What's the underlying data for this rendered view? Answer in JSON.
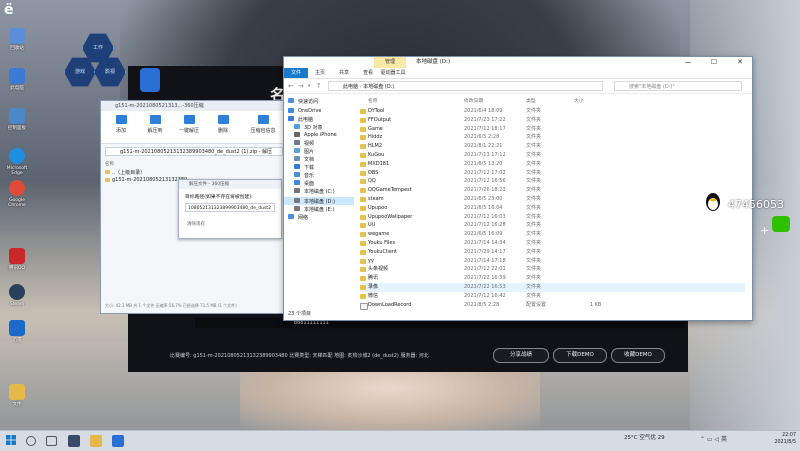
{
  "desktop": {
    "logo_text": "ë",
    "icons": [
      {
        "label": "回收站",
        "color": "#5a8fd8"
      },
      {
        "label": "此电脑",
        "color": "#3b7bd6"
      },
      {
        "label": "控制面板",
        "color": "#4a88c9"
      },
      {
        "label": "Microsoft Edge",
        "color": "#1f8fe0"
      },
      {
        "label": "Google Chrome",
        "color": "#e04a3a"
      },
      {
        "label": "腾讯QQ",
        "color": "#c8282a"
      },
      {
        "label": "Steam",
        "color": "#2a3f5a"
      },
      {
        "label": "迅雷",
        "color": "#1b69c9"
      },
      {
        "label": "文件",
        "color": "#e4b84a"
      }
    ],
    "launcher": [
      "工作",
      "游戏",
      "影视"
    ]
  },
  "stream_overlay": {
    "title": "名 热 沙 坝",
    "user": "bo811111111",
    "info": "比赛编号: g151-m-20210805213132389903480 比赛类型: 天梯匹配 地图: 炙热沙城2 (de_dust2) 服务器: 河北",
    "buttons": [
      "分享战绩",
      "下载DEMO",
      "收藏DEMO"
    ]
  },
  "zip_window": {
    "title": "g151-m-2021080521313...-360压缩",
    "tools": [
      "添加",
      "解压到",
      "一键解压",
      "删除",
      "压缩包信息"
    ],
    "path": "g151-m-20210805213132389903480_de_dust2 (1).zip - 解压",
    "header": "名称",
    "rows": [
      "..（上级目录）",
      "g151-m-20210805213132389..."
    ],
    "status": "大小: 42.1 MB 共 1 个文件 压缩率 56.7% 已经选择 71.5 MB (1 个文件)"
  },
  "extract_dialog": {
    "title": "解压文件 - 360压缩",
    "message": "目标路径(如果不存在将被创建):",
    "target": "108052131323899903480_de_dust2",
    "option": "清除现有"
  },
  "explorer": {
    "context_tab": "管理",
    "window_title": "本地磁盘 (D:)",
    "controls": [
      "—",
      "☐",
      "✕"
    ],
    "ribbon_tabs": [
      "文件",
      "主页",
      "共享",
      "查看",
      "驱动器工具"
    ],
    "address": [
      "此电脑",
      "本地磁盘 (D:)"
    ],
    "search_placeholder": "搜索\"本地磁盘 (D:)\"",
    "nav": [
      {
        "label": "快速访问",
        "color": "#4a8fe0"
      },
      {
        "label": "OneDrive",
        "color": "#3c8be0"
      },
      {
        "label": "此电脑",
        "color": "#3b7bd6"
      },
      {
        "label": "3D 对象",
        "color": "#4fa1d9"
      },
      {
        "label": "Apple iPhone",
        "color": "#666666"
      },
      {
        "label": "视频",
        "color": "#6b7b8c"
      },
      {
        "label": "图片",
        "color": "#5aa6d6"
      },
      {
        "label": "文档",
        "color": "#6b8fb8"
      },
      {
        "label": "下载",
        "color": "#2f7ed8"
      },
      {
        "label": "音乐",
        "color": "#4a8fe0"
      },
      {
        "label": "桌面",
        "color": "#3c8be0"
      },
      {
        "label": "本地磁盘 (C:)",
        "color": "#777777"
      },
      {
        "label": "本地磁盘 (D:)",
        "color": "#777777"
      },
      {
        "label": "本地磁盘 (E:)",
        "color": "#777777"
      },
      {
        "label": "网络",
        "color": "#4a8fe0"
      }
    ],
    "columns": [
      "名称",
      "修改日期",
      "类型",
      "大小"
    ],
    "files": [
      {
        "name": "DYTool",
        "date": "2021/6/4 18:09",
        "type": "文件夹",
        "size": ""
      },
      {
        "name": "FFOutput",
        "date": "2021/7/23 17:22",
        "type": "文件夹",
        "size": ""
      },
      {
        "name": "Game",
        "date": "2021/7/12 18:17",
        "type": "文件夹",
        "size": ""
      },
      {
        "name": "Hiddz",
        "date": "2021/6/5 2:28",
        "type": "文件夹",
        "size": ""
      },
      {
        "name": "HLM2",
        "date": "2021/8/1 22:21",
        "type": "文件夹",
        "size": ""
      },
      {
        "name": "KuGou",
        "date": "2021/7/13 17:12",
        "type": "文件夹",
        "size": ""
      },
      {
        "name": "MXD181",
        "date": "2021/6/5 13:20",
        "type": "文件夹",
        "size": ""
      },
      {
        "name": "OBS",
        "date": "2021/7/12 17:02",
        "type": "文件夹",
        "size": ""
      },
      {
        "name": "QQ",
        "date": "2021/7/12 16:56",
        "type": "文件夹",
        "size": ""
      },
      {
        "name": "QQGameTempest",
        "date": "2021/7/26 18:23",
        "type": "文件夹",
        "size": ""
      },
      {
        "name": "steam",
        "date": "2021/6/5 23:00",
        "type": "文件夹",
        "size": ""
      },
      {
        "name": "Upupoo",
        "date": "2021/6/5 16:04",
        "type": "文件夹",
        "size": ""
      },
      {
        "name": "UpupooWallpaper",
        "date": "2021/7/12 16:03",
        "type": "文件夹",
        "size": ""
      },
      {
        "name": "UU",
        "date": "2021/7/12 16:28",
        "type": "文件夹",
        "size": ""
      },
      {
        "name": "wegame",
        "date": "2021/6/5 16:09",
        "type": "文件夹",
        "size": ""
      },
      {
        "name": "Youku Files",
        "date": "2021/7/14 14:34",
        "type": "文件夹",
        "size": ""
      },
      {
        "name": "YoukuClient",
        "date": "2021/7/29 14:17",
        "type": "文件夹",
        "size": ""
      },
      {
        "name": "yy",
        "date": "2021/7/14 17:18",
        "type": "文件夹",
        "size": ""
      },
      {
        "name": "头条视频",
        "date": "2021/7/12 22:01",
        "type": "文件夹",
        "size": ""
      },
      {
        "name": "腾讯",
        "date": "2021/7/22 16:39",
        "type": "文件夹",
        "size": ""
      },
      {
        "name": "录像",
        "date": "2021/7/22 16:53",
        "type": "文件夹",
        "size": ""
      },
      {
        "name": "微信",
        "date": "2021/7/12 16:42",
        "type": "文件夹",
        "size": ""
      },
      {
        "name": "DownLoadRecord",
        "date": "2021/8/5 2:28",
        "type": "配置设置",
        "size": "1 KB"
      }
    ],
    "status": "23 个项目"
  },
  "chat": {
    "phone": "47456053",
    "plus": "+"
  },
  "taskbar": {
    "weather": "25°C 空气优 29",
    "time": "22:07",
    "date": "2021/8/5",
    "colors": {
      "accent": "#1979ca",
      "folder": "#e8c04d"
    }
  }
}
